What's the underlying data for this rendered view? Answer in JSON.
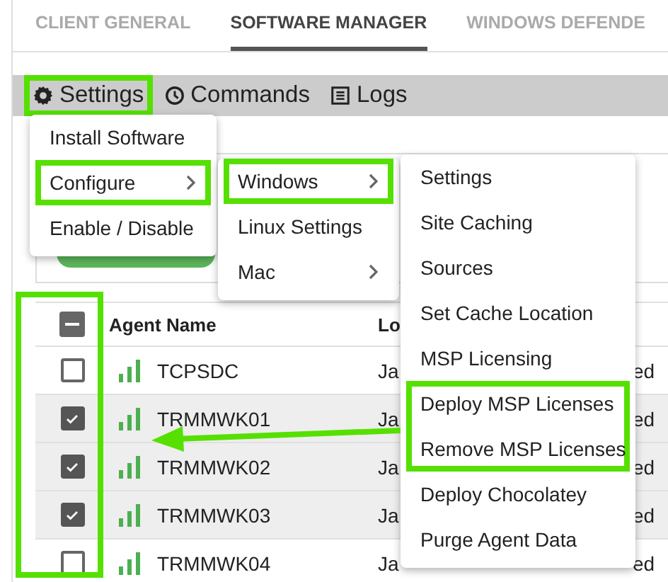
{
  "tabs": [
    {
      "label": "CLIENT GENERAL",
      "selected": false
    },
    {
      "label": "SOFTWARE MANAGER",
      "selected": true
    },
    {
      "label": "WINDOWS DEFENDE",
      "selected": false
    }
  ],
  "toolbar": [
    {
      "label": "Settings",
      "highlighted": true
    },
    {
      "label": "Commands",
      "highlighted": false
    },
    {
      "label": "Logs",
      "highlighted": false
    }
  ],
  "menus": [
    {
      "items": [
        {
          "label": "Install Software",
          "submenu": false,
          "highlighted": false
        },
        {
          "label": "Configure",
          "submenu": true,
          "highlighted": true
        },
        {
          "label": "Enable / Disable",
          "submenu": false,
          "highlighted": false
        }
      ]
    },
    {
      "items": [
        {
          "label": "Windows",
          "submenu": true,
          "highlighted": true
        },
        {
          "label": "Linux Settings",
          "submenu": false,
          "highlighted": false
        },
        {
          "label": "Mac",
          "submenu": true,
          "highlighted": false
        }
      ]
    },
    {
      "items": [
        {
          "label": "Settings",
          "submenu": false,
          "highlighted": false
        },
        {
          "label": "Site Caching",
          "submenu": false,
          "highlighted": false
        },
        {
          "label": "Sources",
          "submenu": false,
          "highlighted": false
        },
        {
          "label": "Set Cache Location",
          "submenu": false,
          "highlighted": false
        },
        {
          "label": "MSP Licensing",
          "submenu": false,
          "highlighted": false
        },
        {
          "label": "Deploy MSP Licenses",
          "submenu": false,
          "highlighted": true
        },
        {
          "label": "Remove MSP Licenses",
          "submenu": false,
          "highlighted": true
        },
        {
          "label": "Deploy Chocolatey",
          "submenu": false,
          "highlighted": false
        },
        {
          "label": "Purge Agent Data",
          "submenu": false,
          "highlighted": false
        }
      ]
    }
  ],
  "table": {
    "columns": [
      "Agent Name",
      "Lo"
    ],
    "header_checkbox_indeterminate": true,
    "checkbox_column_highlighted": true,
    "rows": [
      {
        "name": "TCPSDC",
        "column_3": "Ja",
        "column_4": "ed",
        "checked": false
      },
      {
        "name": "TRMMWK01",
        "column_3": "Ja",
        "column_4": "ed",
        "checked": true
      },
      {
        "name": "TRMMWK02",
        "column_3": "Ja",
        "column_4": "ed",
        "checked": true
      },
      {
        "name": "TRMMWK03",
        "column_3": "Ja",
        "column_4": "ed",
        "checked": true
      },
      {
        "name": "TRMMWK04",
        "column_3": "Ja",
        "column_4": "ed",
        "checked": false
      }
    ]
  },
  "pointer_arrow": true
}
